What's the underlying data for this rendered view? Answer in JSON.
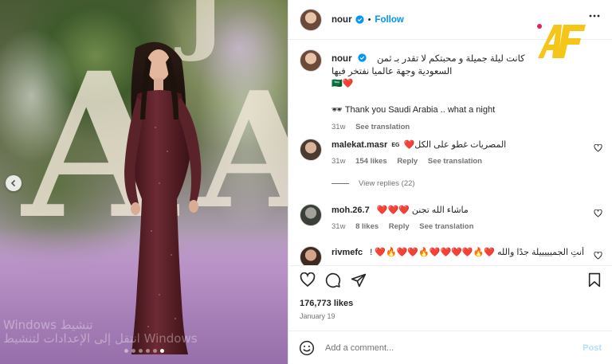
{
  "post": {
    "username": "nour",
    "follow_label": "Follow",
    "caption": {
      "arabic_line1": "كانت ليلة جميلة و محبتكم لا تقدر بـ ثمن",
      "arabic_line2": "السعودية وجهة عالميا نفتخر فيها",
      "emoji_line": "🇸🇦❤️",
      "english_line": "🕶 Thank you Saudi Arabia .. what a night",
      "time": "31w",
      "see_translation": "See translation"
    },
    "comments": [
      {
        "username": "malekat.masr",
        "badge": "EG",
        "text": "المصريات غطو على الكل❤️",
        "time": "31w",
        "likes": "154 likes",
        "reply": "Reply",
        "see_translation": "See translation"
      },
      {
        "username": "moh.26.7",
        "text": "ماشاء الله تجنن ❤️❤️❤️",
        "time": "31w",
        "likes": "8 likes",
        "reply": "Reply",
        "see_translation": "See translation"
      },
      {
        "username": "rivmefc",
        "text": "أنتِ الجميييييلة جدًا والله ❤️🔥❤️❤️❤️❤️🔥❤️❤️🔥❤️ !"
      }
    ],
    "view_replies": "View replies (22)",
    "likes_count": "176,773 likes",
    "date": "January 19",
    "add_comment_placeholder": "Add a comment...",
    "post_label": "Post"
  },
  "photo": {
    "watermark": "Windows تنشيط\nانتقل إلى الإعدادات لتنشيط Windows",
    "carousel_dots": 6,
    "active_dot": 5
  },
  "colors": {
    "accent_blue": "#0095f6",
    "post_disabled": "#b2dffc",
    "heart_red": "#ed4956",
    "logo_yellow": "#f5c518",
    "logo_red_dot": "#e0245e"
  }
}
